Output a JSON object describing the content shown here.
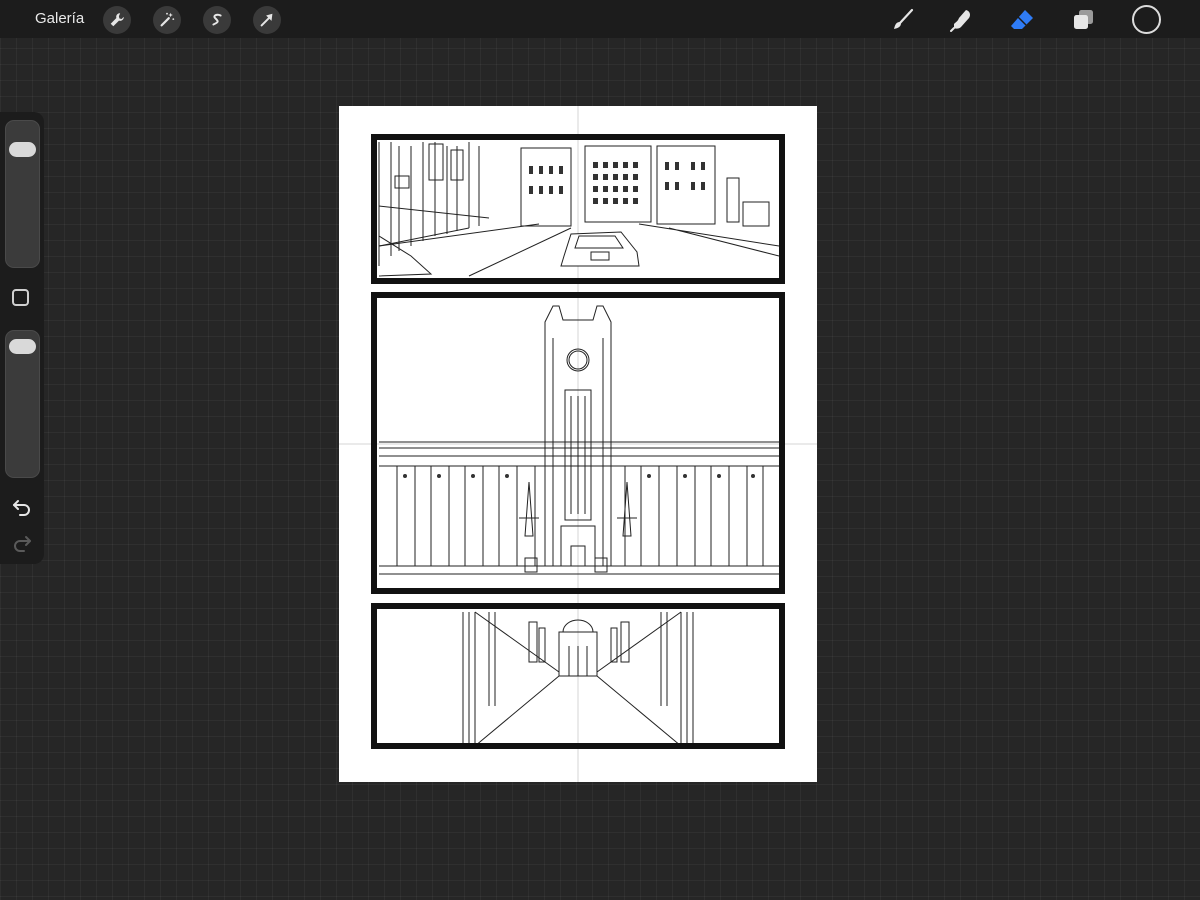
{
  "app": {
    "gallery_label": "Galería"
  },
  "toolbar": {
    "left_tools": [
      {
        "name": "actions",
        "icon": "wrench-icon"
      },
      {
        "name": "adjustments",
        "icon": "magic-wand-icon"
      },
      {
        "name": "selection",
        "icon": "selection-s-icon"
      },
      {
        "name": "transform",
        "icon": "arrow-cursor-icon"
      }
    ],
    "right_tools": [
      {
        "name": "brush",
        "icon": "brush-icon",
        "active": false
      },
      {
        "name": "smudge",
        "icon": "smudge-icon",
        "active": false
      },
      {
        "name": "eraser",
        "icon": "eraser-icon",
        "active": true
      },
      {
        "name": "layers",
        "icon": "layers-icon",
        "active": false
      }
    ],
    "active_tool_color": "#2f7cf6",
    "current_color": "#1c1c1c"
  },
  "sidebar": {
    "brush_size_fraction": 0.86,
    "opacity_fraction": 0.96
  },
  "canvas": {
    "background": "#ffffff",
    "panel_count": 3,
    "line_color": "#111111"
  }
}
